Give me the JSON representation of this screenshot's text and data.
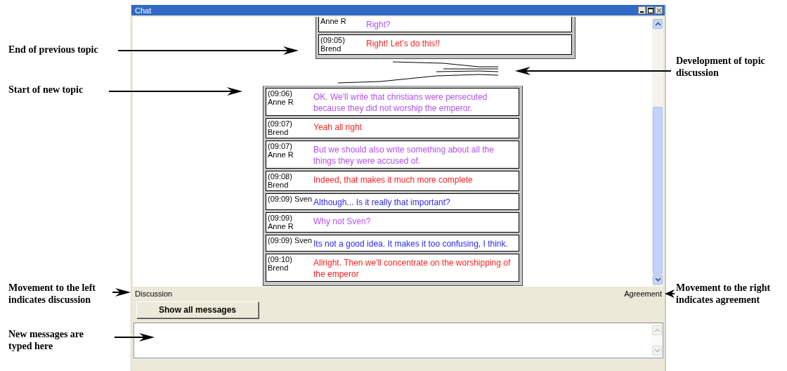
{
  "window": {
    "title": "Chat"
  },
  "topics": [
    {
      "messages": [
        {
          "author": "Anne R",
          "text": "Right?",
          "color": "#b050f0"
        },
        {
          "time": "(09:05)",
          "author": "Brend",
          "text": "Right! Let's do this!!",
          "color": "#ff2020"
        }
      ]
    },
    {
      "messages": [
        {
          "time": "(09:06)",
          "author": "Anne R",
          "text": "OK. We'll write that christians were persecuted because they did not worship the emperor.",
          "color": "#b050f0"
        },
        {
          "time": "(09:07)",
          "author": "Brend",
          "text": "Yeah all right",
          "color": "#ff2020"
        },
        {
          "time": "(09:07)",
          "author": "Anne R",
          "text": "But we should also write something about all the things they were accused of.",
          "color": "#b050f0"
        },
        {
          "time": "(09:08)",
          "author": "Brend",
          "text": "Indeed, that makes it much more complete",
          "color": "#ff2020"
        },
        {
          "time": "(09:09)",
          "author": "Sven",
          "text": "Although... Is it really that important?",
          "color": "#2a2af0"
        },
        {
          "time": "(09:09)",
          "author": "Anne R",
          "text": "Why not Sven?",
          "color": "#b050f0"
        },
        {
          "time": "(09:09)",
          "author": "Sven",
          "text": "Its not a good idea. It makes it too confusing, I think.",
          "color": "#2a2af0"
        },
        {
          "time": "(09:10)",
          "author": "Brend",
          "text": "Allright. Then we'll concentrate on the worshipping of the emperor",
          "color": "#ff2020"
        }
      ]
    }
  ],
  "scale": {
    "left_label": "Discussion",
    "right_label": "Agreement"
  },
  "show_all_button": "Show all messages",
  "annotations": [
    {
      "text": "End of previous topic"
    },
    {
      "text": "Development of topic\ndiscussion"
    },
    {
      "text": "Start of new topic"
    },
    {
      "text": "Movement to the left\nindicates discussion"
    },
    {
      "text": "Movement to the right\nindicates agreement"
    },
    {
      "text": "New messages are\ntyped here"
    }
  ]
}
